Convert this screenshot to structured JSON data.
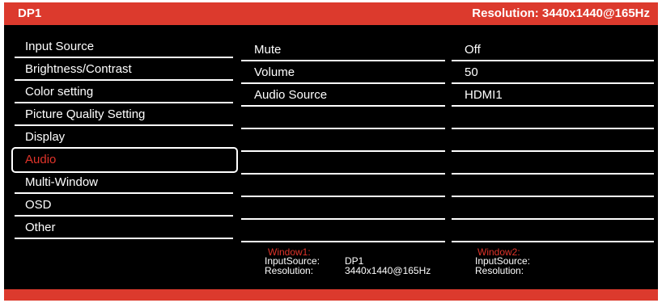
{
  "header": {
    "title": "DP1",
    "resolution": "Resolution: 3440x1440@165Hz"
  },
  "menu": [
    {
      "label": "Input Source"
    },
    {
      "label": "Brightness/Contrast"
    },
    {
      "label": "Color setting"
    },
    {
      "label": "Picture Quality Setting"
    },
    {
      "label": "Display"
    },
    {
      "label": "Audio",
      "selected": true
    },
    {
      "label": "Multi-Window"
    },
    {
      "label": "OSD"
    },
    {
      "label": "Other"
    }
  ],
  "settings": [
    {
      "label": "Mute",
      "value": "Off"
    },
    {
      "label": "Volume",
      "value": "50"
    },
    {
      "label": "Audio Source",
      "value": "HDMI1"
    }
  ],
  "window1": {
    "title": "Window1:",
    "input_label": "InputSource:",
    "input_value": "DP1",
    "res_label": "Resolution:",
    "res_value": "3440x1440@165Hz"
  },
  "window2": {
    "title": "Window2:",
    "input_label": "InputSource:",
    "res_label": "Resolution:"
  },
  "colors": {
    "accent": "#dc3a2d",
    "selected_text": "#e0342a",
    "background": "#000000",
    "text": "#ffffff"
  }
}
